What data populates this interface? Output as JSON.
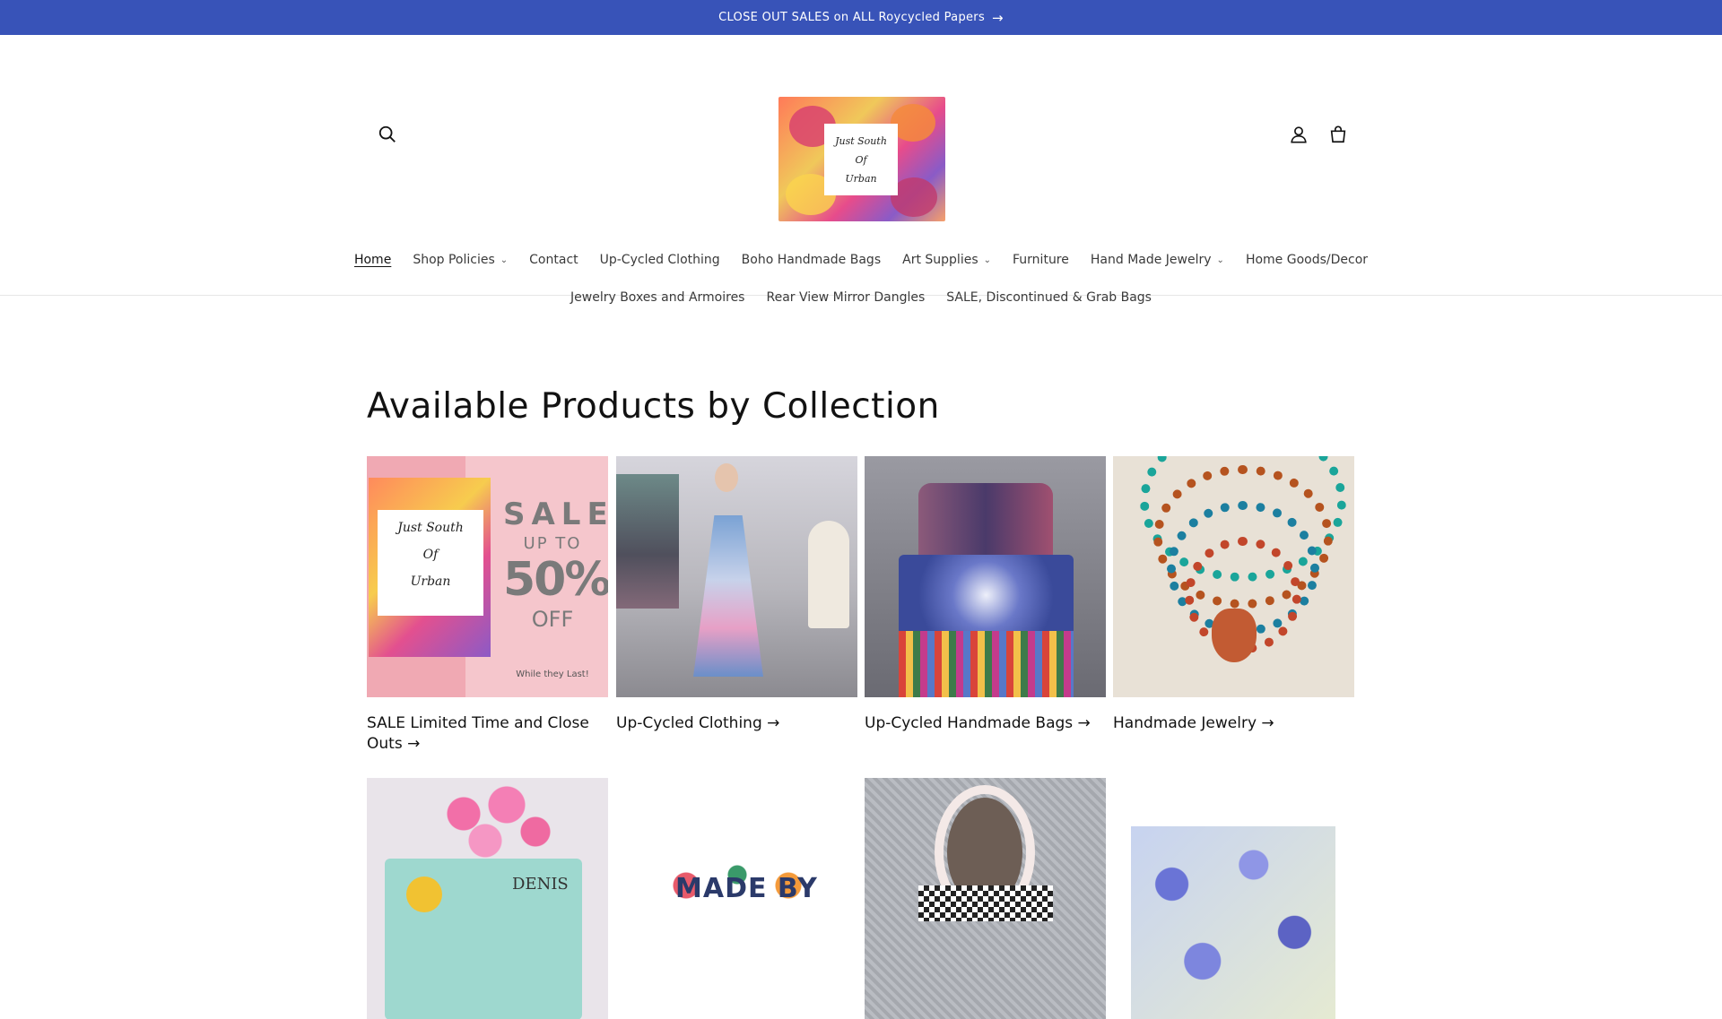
{
  "announcement": {
    "text": "CLOSE OUT SALES on ALL Roycycled Papers",
    "arrow": "→"
  },
  "header": {
    "logo_text": [
      "Just South",
      "Of",
      "Urban"
    ],
    "icons": {
      "search": "search-icon",
      "account": "account-icon",
      "cart": "cart-icon"
    }
  },
  "nav": {
    "row1": [
      {
        "label": "Home",
        "active": true,
        "dropdown": false
      },
      {
        "label": "Shop Policies",
        "dropdown": true
      },
      {
        "label": "Contact",
        "dropdown": false
      },
      {
        "label": "Up-Cycled Clothing",
        "dropdown": false
      },
      {
        "label": "Boho Handmade Bags",
        "dropdown": false
      },
      {
        "label": "Art Supplies",
        "dropdown": true
      },
      {
        "label": "Furniture",
        "dropdown": false
      },
      {
        "label": "Hand Made Jewelry",
        "dropdown": true
      },
      {
        "label": "Home Goods/Decor",
        "dropdown": false
      }
    ],
    "row2": [
      {
        "label": "Jewelry Boxes and Armoires"
      },
      {
        "label": "Rear View Mirror Dangles"
      },
      {
        "label": "SALE, Discontinued & Grab Bags"
      }
    ],
    "chevron": "⌄"
  },
  "main": {
    "title": "Available Products by Collection",
    "collections": [
      {
        "caption": "SALE Limited Time and Close Outs →"
      },
      {
        "caption": "Up-Cycled Clothing →"
      },
      {
        "caption": "Up-Cycled Handmade Bags →"
      },
      {
        "caption": "Handmade Jewelry →"
      }
    ],
    "sale_image": {
      "art_text": [
        "Just South",
        "Of",
        "Urban"
      ],
      "line1": "SALE",
      "line2": "UP TO",
      "line3": "50%",
      "line4": "OFF",
      "line5": "While they Last!"
    },
    "row2_images": {
      "dresser_text": "DENIS",
      "madeby_text": "MADE BY"
    }
  },
  "colors": {
    "announcement_bg": "#3853b8",
    "text": "#121212"
  }
}
